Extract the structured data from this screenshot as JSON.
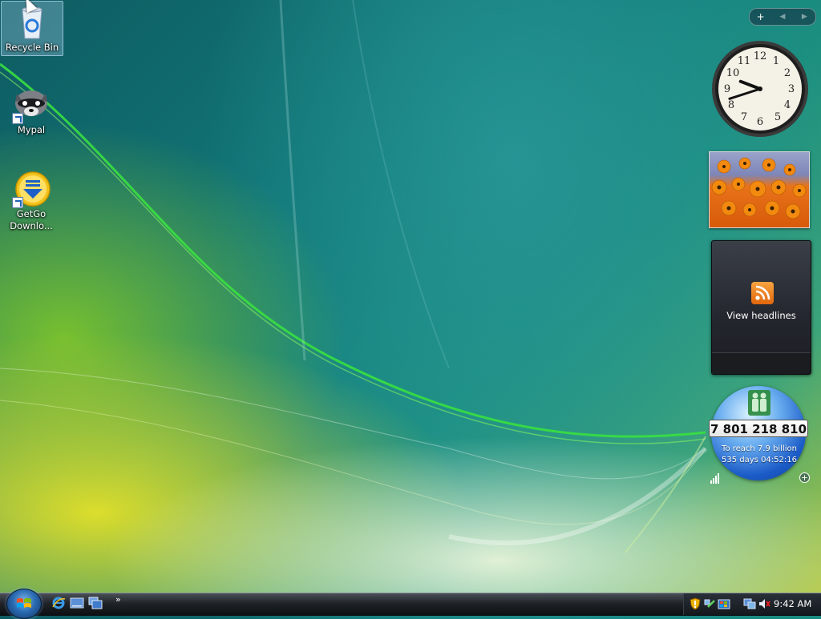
{
  "desktop": {
    "icons": [
      {
        "label": "Recycle Bin",
        "icon": "recycle-bin-icon"
      },
      {
        "label": "Mypal",
        "icon": "mypal-raccoon-icon"
      },
      {
        "label": "GetGo Downlo...",
        "label_line1": "GetGo",
        "label_line2": "Downlo...",
        "icon": "getgo-download-icon"
      }
    ]
  },
  "sidebar": {
    "controls": {
      "add": "+",
      "prev": "◀",
      "next": "▶"
    },
    "clock": {
      "hour": 9,
      "minute": 42
    },
    "photo": {
      "icon": "orange-flowers-photo"
    },
    "feed": {
      "label": "View headlines",
      "icon": "rss-feed-icon"
    },
    "population": {
      "count": "7 801 218 810",
      "line1": "To reach 7.9 billion",
      "line2": "535 days 04:52:16",
      "icon": "people-icon"
    }
  },
  "taskbar": {
    "start": {
      "icon": "windows-start-orb-icon"
    },
    "quick_launch": [
      {
        "icon": "internet-explorer-icon"
      },
      {
        "icon": "show-desktop-icon"
      },
      {
        "icon": "switch-windows-icon"
      }
    ],
    "more": "»",
    "tray": {
      "icons": [
        "security-shield-icon",
        "network-icon",
        "windows-update-icon",
        "display-icon",
        "volume-muted-icon"
      ],
      "time": "9:42 AM"
    }
  }
}
